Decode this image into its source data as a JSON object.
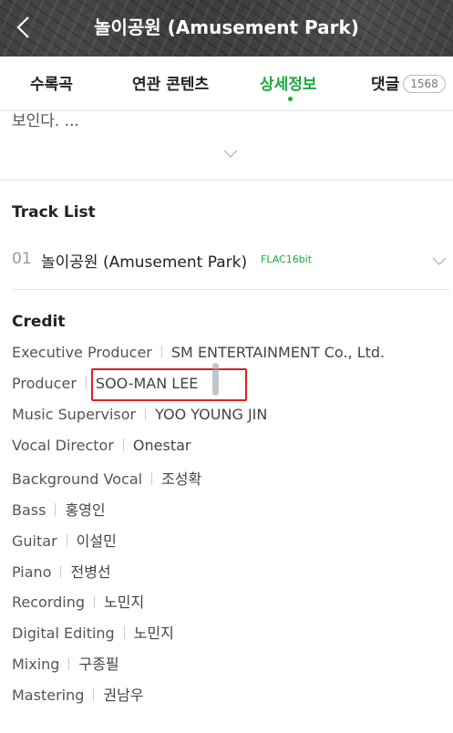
{
  "header": {
    "title": "놀이공원 (Amusement Park)"
  },
  "tabs": [
    {
      "label": "수록곡"
    },
    {
      "label": "연관 콘텐츠"
    },
    {
      "label": "상세정보",
      "active": true
    },
    {
      "label": "댓글",
      "badge": "1568"
    }
  ],
  "description": {
    "fragment": "보인다. ..."
  },
  "track_list": {
    "title": "Track List",
    "tracks": [
      {
        "number": "01",
        "title": "놀이공원 (Amusement Park)",
        "quality": "FLAC16bit"
      }
    ]
  },
  "credit": {
    "title": "Credit",
    "rows": [
      {
        "role": "Executive Producer",
        "name": "SM ENTERTAINMENT Co., Ltd."
      },
      {
        "role": "Producer",
        "name": "SOO-MAN LEE"
      },
      {
        "role": "Music Supervisor",
        "name": "YOO YOUNG JIN"
      },
      {
        "role": "Vocal Director",
        "name": "Onestar"
      },
      {
        "role": "Background Vocal",
        "name": "조성확"
      },
      {
        "role": "Bass",
        "name": "홍영인"
      },
      {
        "role": "Guitar",
        "name": "이설민"
      },
      {
        "role": "Piano",
        "name": "전병선"
      },
      {
        "role": "Recording",
        "name": "노민지"
      },
      {
        "role": "Digital Editing",
        "name": "노민지"
      },
      {
        "role": "Mixing",
        "name": "구종필"
      },
      {
        "role": "Mastering",
        "name": "권남우"
      }
    ]
  },
  "colors": {
    "accent": "#1aaa3c",
    "highlight": "#e02020"
  }
}
